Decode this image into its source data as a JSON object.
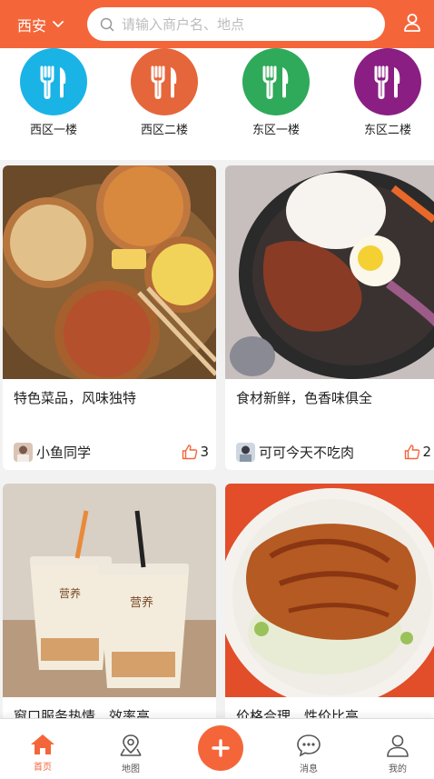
{
  "header": {
    "city": "西安",
    "search_placeholder": "请输入商户名、地点"
  },
  "categories": [
    {
      "label": "西区一楼",
      "color": "#1ab3e6"
    },
    {
      "label": "西区二楼",
      "color": "#e5663a"
    },
    {
      "label": "东区一楼",
      "color": "#2fa95a"
    },
    {
      "label": "东区二楼",
      "color": "#8a1e83"
    }
  ],
  "posts": [
    {
      "title": "特色菜品，风味独特",
      "author": "小鱼同学",
      "likes": "3"
    },
    {
      "title": "食材新鲜，色香味俱全",
      "author": "可可今天不吃肉",
      "likes": "2"
    },
    {
      "title": "窗口服务热情，效率高",
      "author": "",
      "likes": ""
    },
    {
      "title": "价格合理，性价比高",
      "author": "",
      "likes": ""
    }
  ],
  "tabbar": {
    "home": "首页",
    "map": "地图",
    "messages": "消息",
    "mine": "我的"
  },
  "colors": {
    "accent": "#f4663a"
  }
}
